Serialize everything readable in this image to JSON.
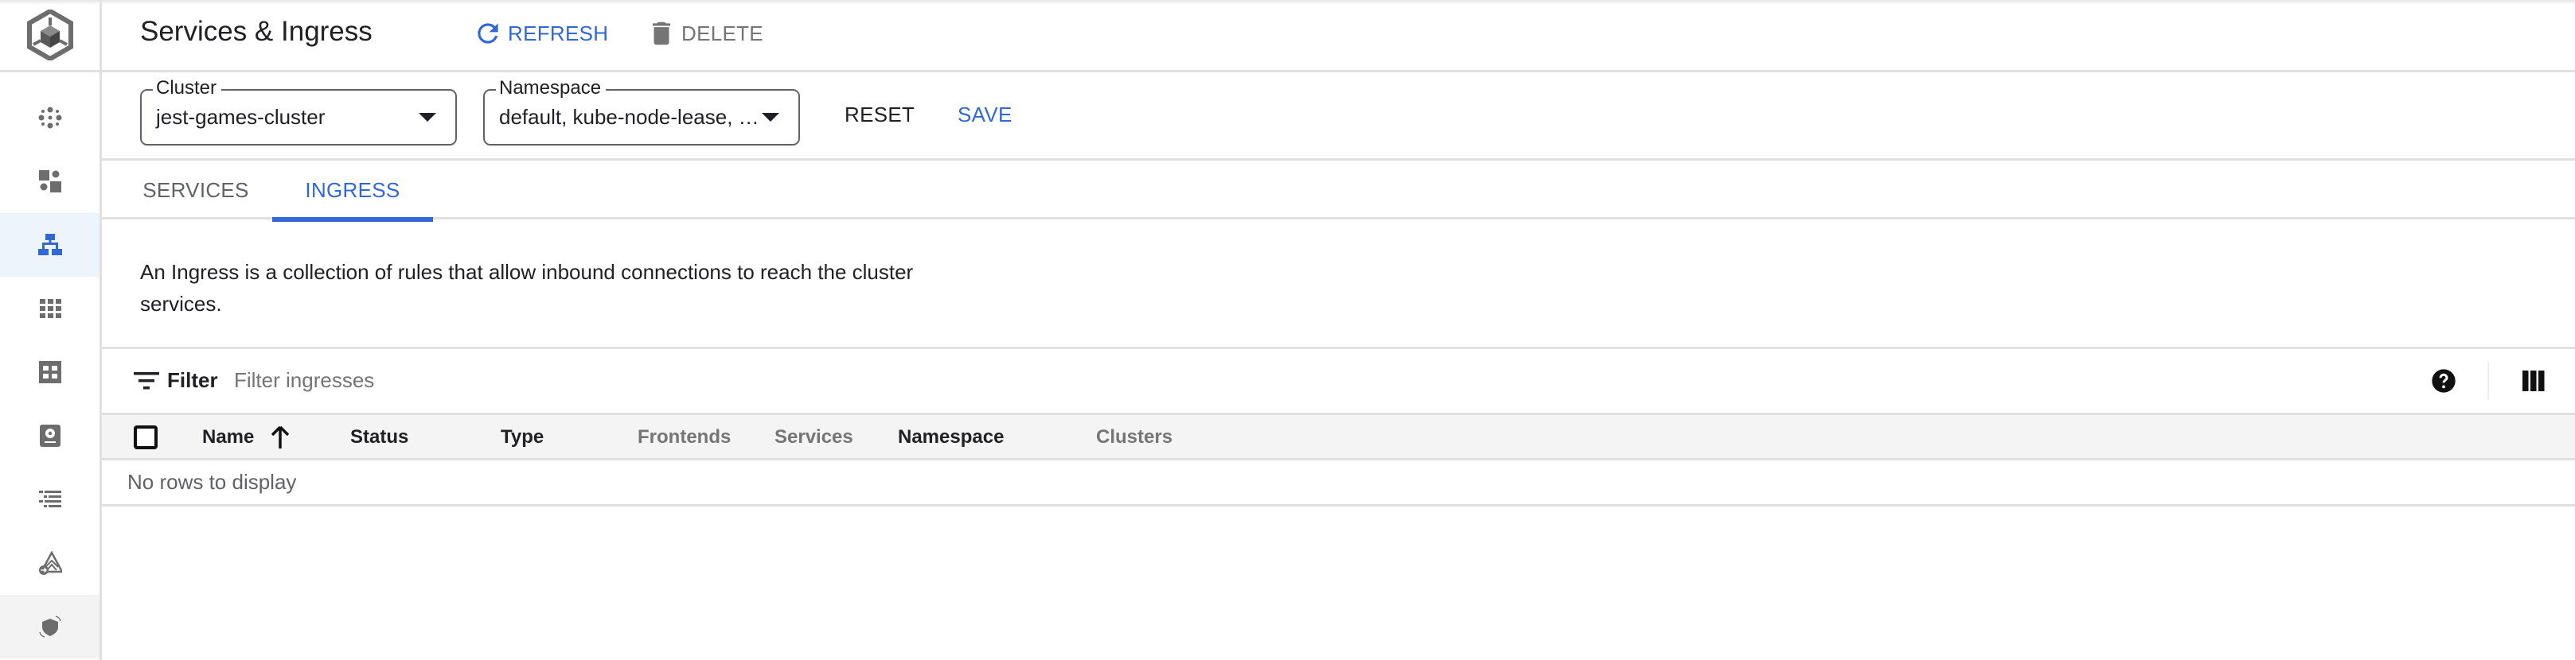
{
  "header": {
    "title": "Services & Ingress",
    "refresh_label": "REFRESH",
    "delete_label": "DELETE"
  },
  "sidebar": {
    "logo": "cube-logo",
    "items": [
      {
        "icon": "clusters-icon",
        "selected": false
      },
      {
        "icon": "workloads-icon",
        "selected": false
      },
      {
        "icon": "services-ingress-icon",
        "selected": true
      },
      {
        "icon": "applications-icon",
        "selected": false
      },
      {
        "icon": "configuration-icon",
        "selected": false
      },
      {
        "icon": "storage-icon",
        "selected": false
      },
      {
        "icon": "object-browser-icon",
        "selected": false
      },
      {
        "icon": "migrate-icon",
        "selected": false
      },
      {
        "icon": "security-icon",
        "selected": false,
        "hovered": true
      }
    ]
  },
  "toolbar": {
    "cluster": {
      "label": "Cluster",
      "value": "jest-games-cluster"
    },
    "namespace": {
      "label": "Namespace",
      "value": "default, kube-node-lease, …"
    },
    "reset_label": "RESET",
    "save_label": "SAVE"
  },
  "tabs": [
    {
      "label": "SERVICES",
      "active": false
    },
    {
      "label": "INGRESS",
      "active": true
    }
  ],
  "description": "An Ingress is a collection of rules that allow inbound connections to reach the cluster services.",
  "filter": {
    "label": "Filter",
    "placeholder": "Filter ingresses",
    "value": ""
  },
  "table": {
    "columns": [
      {
        "label": "Name",
        "sortable": true,
        "sort": "ascending"
      },
      {
        "label": "Status",
        "sortable": true
      },
      {
        "label": "Type",
        "sortable": true
      },
      {
        "label": "Frontends",
        "sortable": false
      },
      {
        "label": "Services",
        "sortable": false
      },
      {
        "label": "Namespace",
        "sortable": true
      },
      {
        "label": "Clusters",
        "sortable": false
      }
    ],
    "rows": [],
    "empty_message": "No rows to display"
  },
  "colors": {
    "accent": "#3367d6",
    "selected_nav_bg": "#eef4fc",
    "icon_gray": "#6d6d6d",
    "border": "#e0e0e0",
    "table_header_bg": "#f4f4f4"
  }
}
